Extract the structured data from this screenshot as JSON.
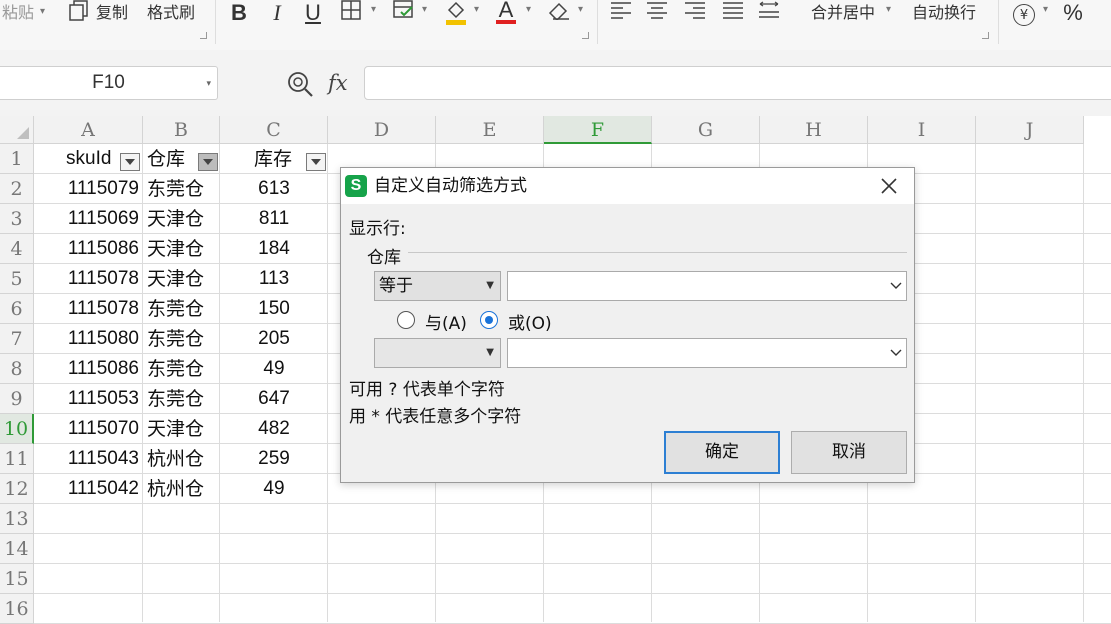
{
  "toolbar": {
    "paste_label": "粘贴",
    "copy_label": "复制",
    "format_painter_label": "格式刷",
    "bold_label": "B",
    "italic_label": "I",
    "underline_label": "U",
    "font_color_label": "A",
    "merge_center_label": "合并居中",
    "wrap_text_label": "自动换行",
    "currency_symbol": "¥",
    "percent_label": "%",
    "font_color_accent": "#e02020",
    "fill_color_accent": "#f2c200"
  },
  "formula_bar": {
    "cell_ref": "F10",
    "fx_label": "fx",
    "formula": ""
  },
  "sheet": {
    "columns": [
      "A",
      "B",
      "C",
      "D",
      "E",
      "F",
      "G",
      "H",
      "I",
      "J"
    ],
    "active_column": "F",
    "row_numbers": [
      "1",
      "2",
      "3",
      "4",
      "5",
      "6",
      "7",
      "8",
      "9",
      "10",
      "11",
      "12",
      "13",
      "14",
      "15",
      "16"
    ],
    "active_row": "10",
    "headers": {
      "a": "skuId",
      "b": "仓库",
      "c": "库存"
    },
    "rows": [
      {
        "sku": "1115079",
        "warehouse": "东莞仓",
        "stock": "613"
      },
      {
        "sku": "1115069",
        "warehouse": "天津仓",
        "stock": "811"
      },
      {
        "sku": "1115086",
        "warehouse": "天津仓",
        "stock": "184"
      },
      {
        "sku": "1115078",
        "warehouse": "天津仓",
        "stock": "113"
      },
      {
        "sku": "1115078",
        "warehouse": "东莞仓",
        "stock": "150"
      },
      {
        "sku": "1115080",
        "warehouse": "东莞仓",
        "stock": "205"
      },
      {
        "sku": "1115086",
        "warehouse": "东莞仓",
        "stock": "49"
      },
      {
        "sku": "1115053",
        "warehouse": "东莞仓",
        "stock": "647"
      },
      {
        "sku": "1115070",
        "warehouse": "天津仓",
        "stock": "482"
      },
      {
        "sku": "1115043",
        "warehouse": "杭州仓",
        "stock": "259"
      },
      {
        "sku": "1115042",
        "warehouse": "杭州仓",
        "stock": "49"
      }
    ],
    "accent_color": "#2f9a37"
  },
  "dialog": {
    "title": "自定义自动筛选方式",
    "show_rows_label": "显示行:",
    "field_label": "仓库",
    "condition1_operator": "等于",
    "condition1_value": "",
    "and_label": "与(A)",
    "or_label": "或(O)",
    "selected_logic": "or",
    "condition2_operator": "",
    "condition2_value": "",
    "hint1": "可用 ? 代表单个字符",
    "hint2": "用 * 代表任意多个字符",
    "ok_label": "确定",
    "cancel_label": "取消",
    "app_icon_label": "S",
    "close_icon": "close-icon",
    "primary_color": "#2d7fd3"
  }
}
